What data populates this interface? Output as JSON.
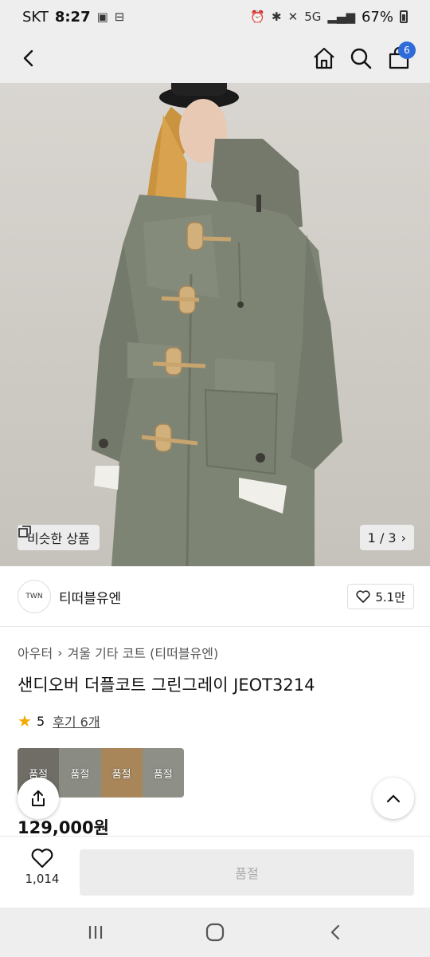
{
  "status_bar": {
    "carrier": "SKT",
    "time": "8:27",
    "network": "5G",
    "battery": "67%"
  },
  "header": {
    "cart_count": "6"
  },
  "hero": {
    "similar_label": "비슷한 상품",
    "image_counter": "1 / 3"
  },
  "brand": {
    "logo_text": "TWN",
    "name": "티떠블유엔",
    "likes": "5.1만"
  },
  "product": {
    "category_parent": "아우터",
    "category_child": "겨울 기타 코트 (티떠블유엔)",
    "title": "샌디오버 더플코트 그린그레이 JEOT3214",
    "rating": "5",
    "review_link": "후기 6개",
    "options": [
      {
        "label": "품절",
        "color": "#6f6d66"
      },
      {
        "label": "품절",
        "color": "#8a8c84"
      },
      {
        "label": "품절",
        "color": "#a8865a"
      },
      {
        "label": "품절",
        "color": "#8e8f86"
      }
    ],
    "price": "129,000원"
  },
  "action_bar": {
    "wish_count": "1,014",
    "buy_label": "품절"
  },
  "colors": {
    "accent": "#2f6bd8",
    "star": "#f2a900",
    "coat": "#7e8474"
  }
}
